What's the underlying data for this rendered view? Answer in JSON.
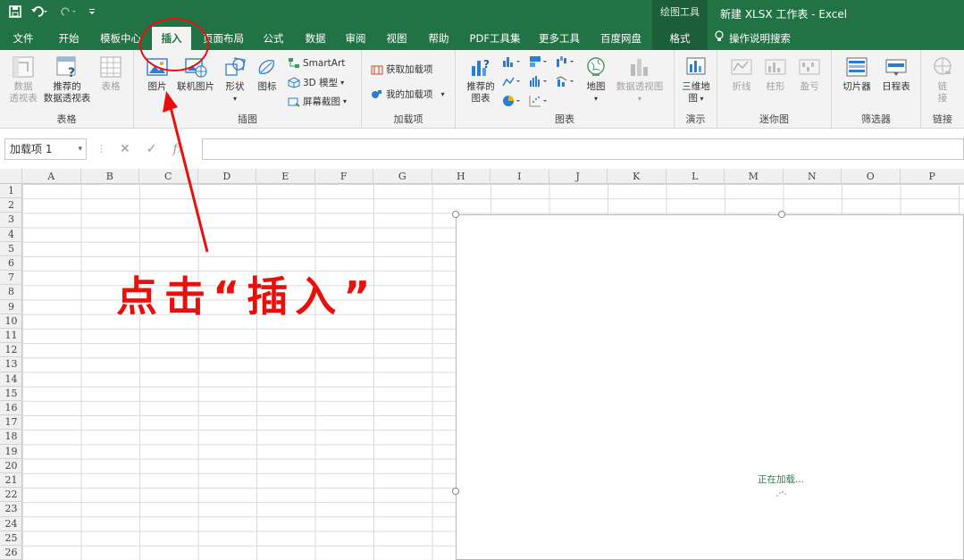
{
  "titlebar": {
    "save_icon": "save-icon",
    "undo_icon": "undo-icon",
    "redo_icon": "redo-icon",
    "context_tool": "绘图工具",
    "doc_title": "新建 XLSX 工作表  -  Excel"
  },
  "tabs": [
    "文件",
    "开始",
    "模板中心",
    "插入",
    "页面布局",
    "公式",
    "数据",
    "审阅",
    "视图",
    "帮助",
    "PDF工具集",
    "更多工具",
    "百度网盘",
    "格式"
  ],
  "tell_me": "操作说明搜索",
  "ribbon": {
    "groups": {
      "tables": "表格",
      "illustrations": "插图",
      "addins": "加载项",
      "charts": "图表",
      "tours": "演示",
      "sparklines": "迷你图",
      "filters": "筛选器",
      "links": "链接"
    },
    "pivot": "数据透视表",
    "pivot_l1": "数据",
    "pivot_l2": "透视表",
    "rec_pivot_l1": "推荐的",
    "rec_pivot_l2": "数据透视表",
    "table": "表格",
    "picture": "图片",
    "online_picture": "联机图片",
    "shapes": "形状",
    "icons": "图标",
    "smartart": "SmartArt",
    "model3d": "3D 模型",
    "screenshot": "屏幕截图",
    "get_addins": "获取加载项",
    "my_addins": "我的加载项",
    "rec_charts_l1": "推荐的",
    "rec_charts_l2": "图表",
    "maps": "地图",
    "pivot_chart": "数据透视图",
    "map3d_l1": "三维地",
    "map3d_l2": "图",
    "line": "折线",
    "column": "柱形",
    "winloss": "盈亏",
    "slicer": "切片器",
    "timeline": "日程表",
    "link_l1": "链",
    "link_l2": "接"
  },
  "namebox": "加载项 1",
  "fx_symbols": {
    "cancel": "✕",
    "enter": "✓",
    "fx": "fx"
  },
  "columns": [
    "A",
    "B",
    "C",
    "D",
    "E",
    "F",
    "G",
    "H",
    "I",
    "J",
    "K",
    "L",
    "M",
    "N",
    "O",
    "P"
  ],
  "rows": [
    "1",
    "2",
    "3",
    "4",
    "5",
    "6",
    "7",
    "8",
    "9",
    "10",
    "11",
    "12",
    "13",
    "14",
    "15",
    "16",
    "17",
    "18",
    "19",
    "20",
    "21",
    "22",
    "23",
    "24",
    "25",
    "26"
  ],
  "panel": {
    "loading": "正在加载..."
  },
  "annotation": {
    "text": "点击“插入”",
    "color": "#e8100c"
  },
  "colors": {
    "excel_green": "#217346",
    "ribbon_bg": "#f3f3f3",
    "annotation_red": "#e8100c"
  }
}
